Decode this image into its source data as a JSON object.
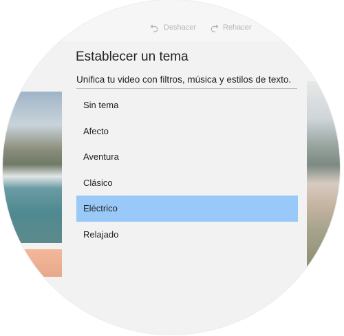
{
  "toolbar": {
    "undo_label": "Deshacer",
    "redo_label": "Rehacer"
  },
  "theme_panel": {
    "title": "Establecer un tema",
    "subtitle": "Unifica tu video con filtros, música y estilos de texto.",
    "items": [
      {
        "label": "Sin tema"
      },
      {
        "label": "Afecto"
      },
      {
        "label": "Aventura"
      },
      {
        "label": "Clásico"
      },
      {
        "label": "Eléctrico"
      },
      {
        "label": "Relajado"
      }
    ],
    "selected_index": 4,
    "selected_color": "#99c9f8"
  }
}
